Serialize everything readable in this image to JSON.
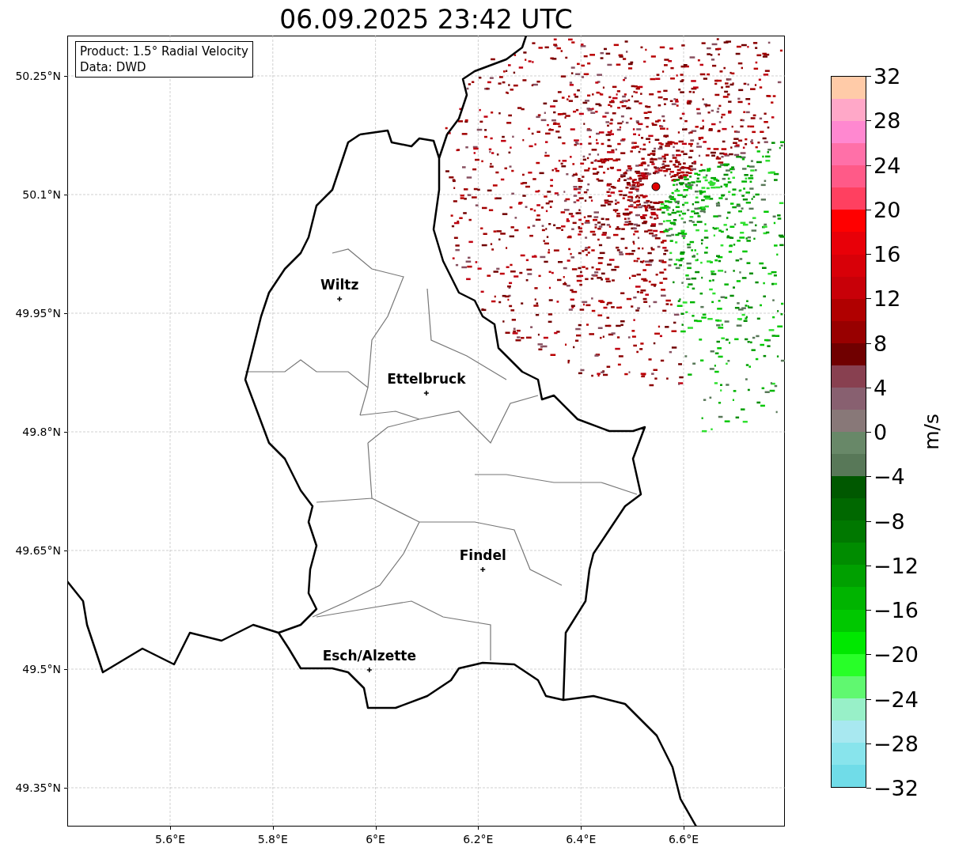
{
  "title": "06.09.2025 23:42 UTC",
  "info_box": {
    "lines": [
      "Product: 1.5° Radial Velocity",
      "Data: DWD"
    ]
  },
  "map": {
    "y_ticks": [
      "50.25°N",
      "50.1°N",
      "49.95°N",
      "49.8°N",
      "49.65°N",
      "49.5°N",
      "49.35°N"
    ],
    "x_ticks": [
      "5.6°E",
      "5.8°E",
      "6°E",
      "6.2°E",
      "6.4°E",
      "6.6°E"
    ],
    "cities": [
      {
        "name": "Wiltz"
      },
      {
        "name": "Ettelbruck"
      },
      {
        "name": "Findel"
      },
      {
        "name": "Esch/Alzette"
      }
    ]
  },
  "colorbar": {
    "label": "m/s",
    "ticks": [
      "32",
      "28",
      "24",
      "20",
      "16",
      "12",
      "8",
      "4",
      "0",
      "−4",
      "−8",
      "−12",
      "−16",
      "−20",
      "−24",
      "−28",
      "−32"
    ],
    "bands": [
      {
        "color": "#ffcba8"
      },
      {
        "color": "#ffa8c8"
      },
      {
        "color": "#ff88d0"
      },
      {
        "color": "#ff70a8"
      },
      {
        "color": "#ff5a88"
      },
      {
        "color": "#ff4060"
      },
      {
        "color": "#ff0000"
      },
      {
        "color": "#e80008"
      },
      {
        "color": "#d80008"
      },
      {
        "color": "#c80008"
      },
      {
        "color": "#b00000"
      },
      {
        "color": "#980000"
      },
      {
        "color": "#700000"
      },
      {
        "color": "#884050"
      },
      {
        "color": "#886070"
      },
      {
        "color": "#887878"
      },
      {
        "color": "#688868"
      },
      {
        "color": "#587858"
      },
      {
        "color": "#005800"
      },
      {
        "color": "#006800"
      },
      {
        "color": "#007800"
      },
      {
        "color": "#008c00"
      },
      {
        "color": "#00a000"
      },
      {
        "color": "#00b400"
      },
      {
        "color": "#00c800"
      },
      {
        "color": "#00e800"
      },
      {
        "color": "#28ff28"
      },
      {
        "color": "#60f870"
      },
      {
        "color": "#98f0c8"
      },
      {
        "color": "#a8e8f0"
      },
      {
        "color": "#88e4ec"
      },
      {
        "color": "#70dce8"
      }
    ]
  }
}
